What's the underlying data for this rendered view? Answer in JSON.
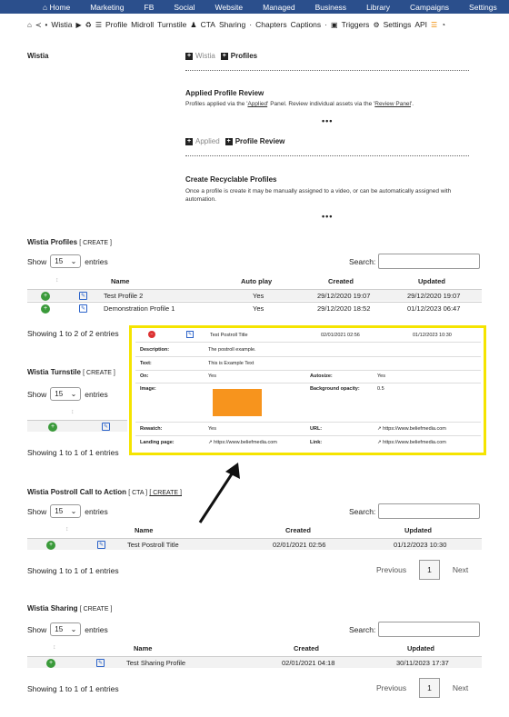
{
  "topnav": {
    "items": [
      "Home",
      "Marketing",
      "FB",
      "Social",
      "Website",
      "Managed",
      "Business",
      "Library",
      "Campaigns",
      "Settings"
    ]
  },
  "subnav": {
    "wistia": "Wistia",
    "profile": "Profile",
    "midroll": "Midroll",
    "turnstile": "Turnstile",
    "cta": "CTA",
    "sharing": "Sharing",
    "chapters": "Chapters",
    "captions": "Captions",
    "triggers": "Triggers",
    "settings": "Settings",
    "api": "API"
  },
  "section_label": "Wistia",
  "tabs1": {
    "inactive": "Wistia",
    "active": "Profiles"
  },
  "applied_block": {
    "title": "Applied Profile Review",
    "text_a": "Profiles applied via the '",
    "link1": "Applied",
    "text_b": "' Panel. Review individual assets via the '",
    "link2": "Review Panel",
    "text_c": "'.",
    "more": "•••"
  },
  "tabs2": {
    "inactive": "Applied",
    "active": "Profile Review"
  },
  "recycle_block": {
    "title": "Create Recyclable Profiles",
    "text": "Once a profile is create it may be manually assigned to a video, or can be automatically assigned with automation.",
    "more": "•••"
  },
  "profiles_table": {
    "title": "Wistia Profiles",
    "action": "[ CREATE ]",
    "show": "Show",
    "entries_val": "15",
    "entries": "entries",
    "search": "Search:",
    "headers": {
      "name": "Name",
      "autoplay": "Auto play",
      "created": "Created",
      "updated": "Updated"
    },
    "rows": [
      {
        "name": "Test Profile 2",
        "autoplay": "Yes",
        "created": "29/12/2020 19:07",
        "updated": "29/12/2020 19:07"
      },
      {
        "name": "Demonstration Profile 1",
        "autoplay": "Yes",
        "created": "29/12/2020 18:52",
        "updated": "01/12/2023 06:47"
      }
    ],
    "info": "Showing 1 to 2 of 2 entries"
  },
  "turnstile_table": {
    "title": "Wistia Turnstile",
    "action": "[ CREATE ]",
    "show": "Show",
    "entries_val": "15",
    "entries": "entries",
    "info": "Showing 1 to 1 of 1 entries"
  },
  "popup": {
    "row": {
      "name": "Test Postroll Title",
      "created": "02/01/2021 02:56",
      "updated": "01/12/2023 10:30"
    },
    "description_label": "Description:",
    "description": "The postroll example.",
    "text_label": "Text:",
    "text": "This is Example Text",
    "on_label": "On:",
    "on": "Yes",
    "autosize_label": "Autosize:",
    "autosize": "Yes",
    "image_label": "Image:",
    "bg_opacity_label": "Background opacity:",
    "bg_opacity": "0.5",
    "rewatch_label": "Rewatch:",
    "rewatch": "Yes",
    "url_label": "URL:",
    "url": "https://www.beliefmedia.com",
    "landing_label": "Landing page:",
    "landing": "https://www.beliefmedia.com",
    "link_label": "Link:",
    "link": "https://www.beliefmedia.com",
    "swatch_color": "#f7941d"
  },
  "postroll_table": {
    "title": "Wistia Postroll Call to Action",
    "action1": "[ CTA ]",
    "action2": "[ CREATE ]",
    "show": "Show",
    "entries_val": "15",
    "entries": "entries",
    "search": "Search:",
    "headers": {
      "name": "Name",
      "created": "Created",
      "updated": "Updated"
    },
    "rows": [
      {
        "name": "Test Postroll Title",
        "created": "02/01/2021 02:56",
        "updated": "01/12/2023 10:30"
      }
    ],
    "info": "Showing 1 to 1 of 1 entries",
    "prev": "Previous",
    "page": "1",
    "next": "Next"
  },
  "sharing_table": {
    "title": "Wistia Sharing",
    "action": "[ CREATE ]",
    "show": "Show",
    "entries_val": "15",
    "entries": "entries",
    "search": "Search:",
    "headers": {
      "name": "Name",
      "created": "Created",
      "updated": "Updated"
    },
    "rows": [
      {
        "name": "Test Sharing Profile",
        "created": "02/01/2021 04:18",
        "updated": "30/11/2023 17:37"
      }
    ],
    "info": "Showing 1 to 1 of 1 entries",
    "prev": "Previous",
    "page": "1",
    "next": "Next"
  },
  "colors": {
    "nav": "#2b4f8c",
    "highlight": "#f5e400",
    "green": "#3a9a3a"
  }
}
